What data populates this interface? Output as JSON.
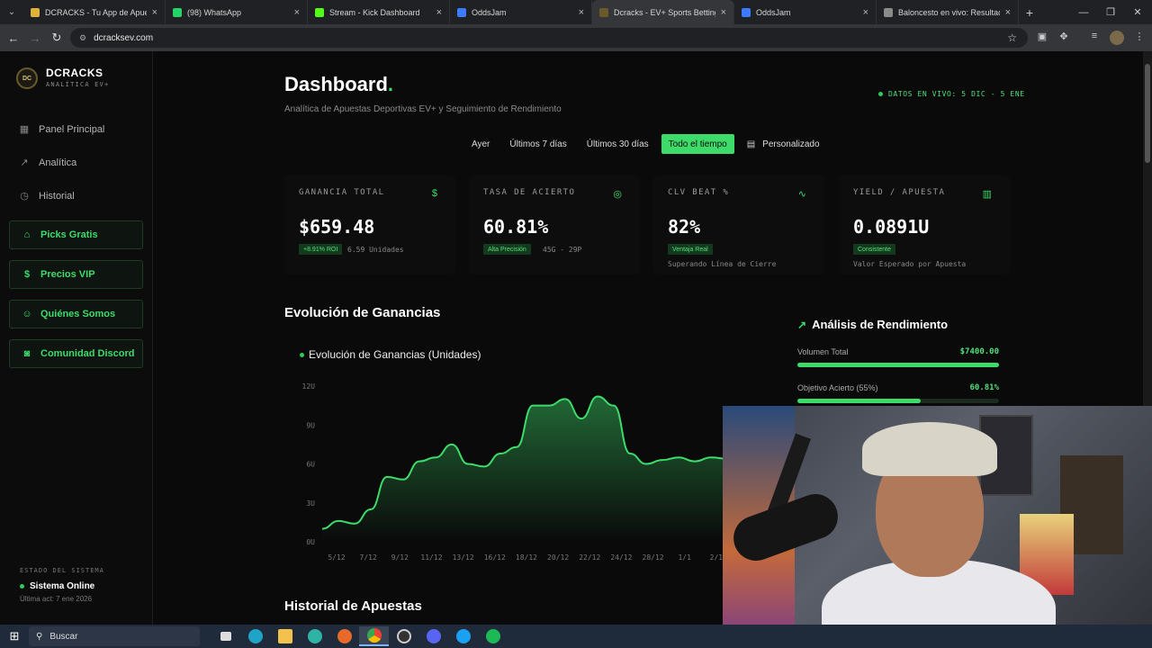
{
  "browser": {
    "tabs": [
      {
        "title": "DCRACKS - Tu App de Apuestas",
        "fav_color": "#e0b23a",
        "width": 158
      },
      {
        "title": "(98) WhatsApp",
        "fav_color": "#25d366",
        "width": 158
      },
      {
        "title": "Stream - Kick Dashboard",
        "fav_color": "#53fc18",
        "width": 158
      },
      {
        "title": "OddsJam",
        "fav_color": "#3a7bff",
        "width": 158
      },
      {
        "title": "Dcracks - EV+ Sports Betting An",
        "fav_color": "#6a5a2a",
        "width": 158,
        "active": true
      },
      {
        "title": "OddsJam",
        "fav_color": "#3a7bff",
        "width": 158
      },
      {
        "title": "Baloncesto en vivo: Resultados",
        "fav_color": "#8a8a8a",
        "width": 158
      }
    ],
    "url": "dcracksev.com"
  },
  "sidebar": {
    "brand": "DCRACKS",
    "brand_sub": "ANALÍTICA EV+",
    "logo_text": "DC",
    "nav": [
      {
        "label": "Panel Principal",
        "icon": "grid-icon"
      },
      {
        "label": "Analítica",
        "icon": "trend-icon"
      },
      {
        "label": "Historial",
        "icon": "history-icon"
      }
    ],
    "buttons": [
      {
        "label": "Picks Gratis",
        "icon": "gift-icon"
      },
      {
        "label": "Precios VIP",
        "icon": "dollar-icon"
      },
      {
        "label": "Quiénes Somos",
        "icon": "users-icon"
      },
      {
        "label": "Comunidad Discord",
        "icon": "discord-icon"
      }
    ],
    "system_label": "ESTADO DEL SISTEMA",
    "system_status": "Sistema Online",
    "system_updated": "Última act: 7 ene 2026"
  },
  "main": {
    "title": "Dashboard",
    "title_dot": ".",
    "subtitle": "Analítica de Apuestas Deportivas EV+ y Seguimiento de Rendimiento",
    "live": "DATOS EN VIVO: 5 DIC - 5 ENE",
    "filters": [
      "Ayer",
      "Últimos 7 días",
      "Últimos 30 días",
      "Todo el tiempo",
      "Personalizado"
    ],
    "active_filter": "Todo el tiempo",
    "cards": [
      {
        "label": "GANANCIA TOTAL",
        "value": "$659.48",
        "badge": "+8.91% ROI",
        "aux": "6.59 Unidades",
        "note": "",
        "icon": "$"
      },
      {
        "label": "TASA DE ACIERTO",
        "value": "60.81%",
        "badge": "Alta Precisión",
        "aux": "45G - 29P",
        "note": "",
        "icon": "◎"
      },
      {
        "label": "CLV BEAT %",
        "value": "82%",
        "badge": "Ventaja Real",
        "aux": "",
        "note": "Superando Línea de Cierre",
        "icon": "∿"
      },
      {
        "label": "YIELD / APUESTA",
        "value": "0.0891U",
        "badge": "Consistente",
        "aux": "",
        "note": "Valor Esperado por Apuesta",
        "icon": "▥"
      }
    ],
    "section_evolution": "Evolución de Ganancias",
    "chart_title": "Evolución de Ganancias (Unidades)",
    "performance": {
      "title": "Análisis de Rendimiento",
      "rows": [
        {
          "label": "Volumen Total",
          "value": "$7400.00",
          "fill": 1.0
        },
        {
          "label": "Objetivo Acierto (55%)",
          "value": "60.81%",
          "fill": 0.61
        }
      ]
    },
    "section_history": "Historial de Apuestas"
  },
  "taskbar": {
    "search": "Buscar"
  },
  "chart_data": {
    "type": "area",
    "title": "Evolución de Ganancias (Unidades)",
    "xlabel": "",
    "ylabel": "",
    "ylim": [
      0,
      12
    ],
    "y_ticks": [
      "0U",
      "3U",
      "6U",
      "9U",
      "12U"
    ],
    "x_ticks": [
      "5/12",
      "7/12",
      "9/12",
      "11/12",
      "13/12",
      "16/12",
      "18/12",
      "20/12",
      "22/12",
      "24/12",
      "28/12",
      "1/1",
      "2/1"
    ],
    "x": [
      0,
      0.5,
      1,
      1.5,
      2,
      2.5,
      3,
      3.5,
      4,
      4.5,
      5,
      5.5,
      6,
      6.5,
      7,
      7.5,
      8,
      8.5,
      9,
      9.5,
      10,
      10.5,
      11,
      11.5,
      12,
      12.5
    ],
    "values": [
      1.0,
      1.6,
      1.4,
      2.5,
      5.0,
      4.8,
      6.2,
      6.5,
      7.5,
      6.0,
      5.8,
      6.8,
      7.3,
      10.5,
      10.5,
      11.0,
      9.5,
      11.2,
      10.5,
      6.8,
      6.0,
      6.3,
      6.5,
      6.2,
      6.5,
      6.4
    ],
    "color": "#3ddb6a",
    "grid": false
  }
}
